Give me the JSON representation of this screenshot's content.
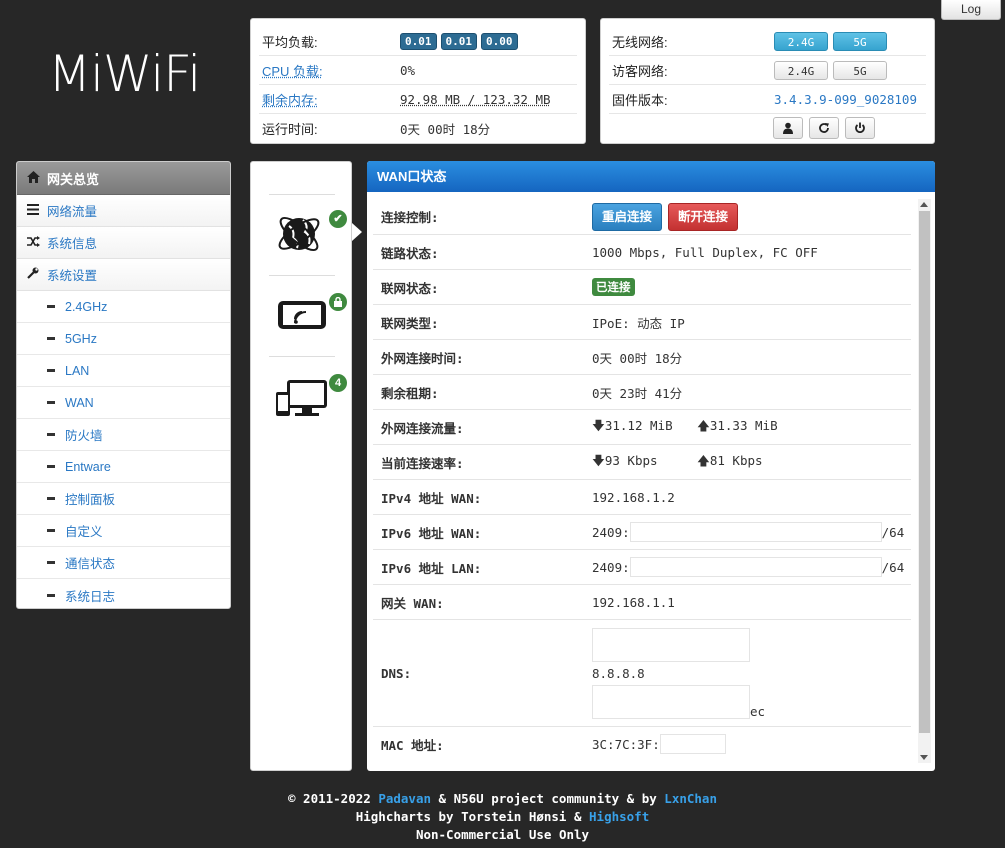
{
  "logo": "MiWiFi",
  "log_button": "Log",
  "load_panel": {
    "avg_load_label": "平均负载:",
    "avg_load_values": [
      "0.01",
      "0.01",
      "0.00"
    ],
    "cpu_label": "CPU 负载:",
    "cpu_value": "0%",
    "mem_label": "剩余内存:",
    "mem_value": "92.98 MB / 123.32 MB",
    "uptime_label": "运行时间:",
    "uptime_value": "0天 00时 18分"
  },
  "wifi_panel": {
    "wireless_label": "无线网络:",
    "wireless_buttons": [
      "2.4G",
      "5G"
    ],
    "guest_label": "访客网络:",
    "guest_buttons": [
      "2.4G",
      "5G"
    ],
    "firmware_label": "固件版本:",
    "firmware_value": "3.4.3.9-099_9028109"
  },
  "sidebar": {
    "header": "网关总览",
    "items": [
      {
        "label": "网络流量",
        "icon": "list-icon"
      },
      {
        "label": "系统信息",
        "icon": "shuffle-icon"
      },
      {
        "label": "系统设置",
        "icon": "wrench-icon"
      }
    ],
    "subitems": [
      "2.4GHz",
      "5GHz",
      "LAN",
      "WAN",
      "防火墙",
      "Entware",
      "控制面板",
      "自定义",
      "通信状态",
      "系统日志"
    ]
  },
  "icons": {
    "clients_count": "4"
  },
  "wan": {
    "title": "WAN口状态",
    "rows": {
      "control_label": "连接控制:",
      "restart_btn": "重启连接",
      "disconnect_btn": "断开连接",
      "link_label": "链路状态:",
      "link_value": "1000 Mbps, Full Duplex, FC OFF",
      "net_label": "联网状态:",
      "net_value": "已连接",
      "type_label": "联网类型:",
      "type_value": "IPoE: 动态 IP",
      "conn_time_label": "外网连接时间:",
      "conn_time_value": "0天 00时 18分",
      "lease_label": "剩余租期:",
      "lease_value": "0天 23时 41分",
      "traffic_label": "外网连接流量:",
      "traffic_down": "31.12 MiB",
      "traffic_up": "31.33 MiB",
      "speed_label": "当前连接速率:",
      "speed_down": "93 Kbps",
      "speed_up": "81 Kbps",
      "ipv4_label": "IPv4 地址 WAN:",
      "ipv4_value": "192.168.1.2",
      "ipv6_wan_label": "IPv6 地址 WAN:",
      "ipv6_wan_prefix": "2409:",
      "ipv6_wan_suffix": "/64",
      "ipv6_lan_label": "IPv6 地址 LAN:",
      "ipv6_lan_prefix": "2409:",
      "ipv6_lan_suffix": "/64",
      "gw_label": "网关 WAN:",
      "gw_value": "192.168.1.1",
      "dns_label": "DNS:",
      "dns_value": "8.8.8.8",
      "dns_tail": "ec",
      "mac_label": "MAC 地址:",
      "mac_value": "3C:7C:3F:"
    }
  },
  "footer": {
    "line1_a": "© 2011-2022 ",
    "line1_padavan": "Padavan",
    "line1_b": " & N56U project community & by ",
    "line1_lxn": "LxnChan",
    "line2_a": "Highcharts by Torstein Hønsi & ",
    "line2_highsoft": "Highsoft",
    "line3": "Non-Commercial Use Only"
  }
}
